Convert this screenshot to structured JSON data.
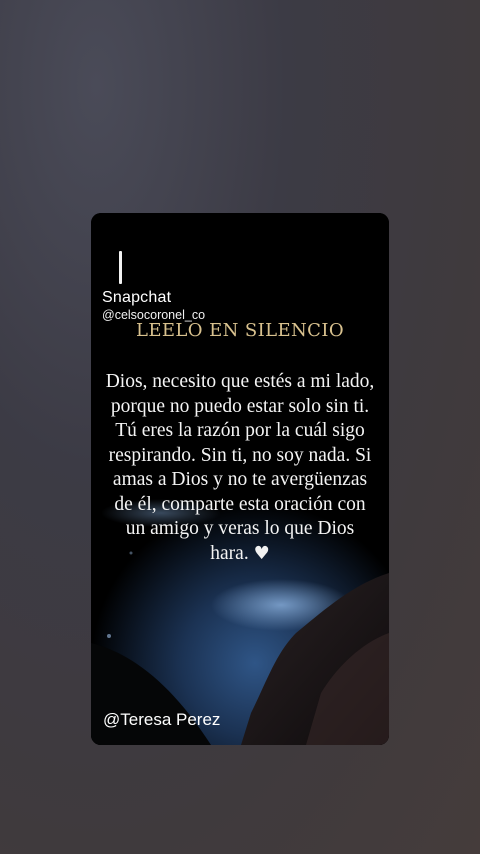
{
  "story": {
    "app_name": "Snapchat",
    "handle": "@celsocoronel_co",
    "title": "LEELO EN SILENCIO",
    "message": "Dios, necesito que estés a mi lado, porque no puedo estar solo sin ti. Tú eres la razón por la cuál sigo respirando. Sin ti, no soy nada. Si amas a Dios y no te avergüenzas de él, comparte esta oración con un amigo y veras lo que Dios hara.",
    "heart_icon": "white-heart",
    "author": "@Teresa Perez"
  },
  "colors": {
    "background": "#3f3d47",
    "card": "#000000",
    "title": "#d9c28f",
    "text": "#f4f4f4",
    "water": "#1e3a66"
  }
}
